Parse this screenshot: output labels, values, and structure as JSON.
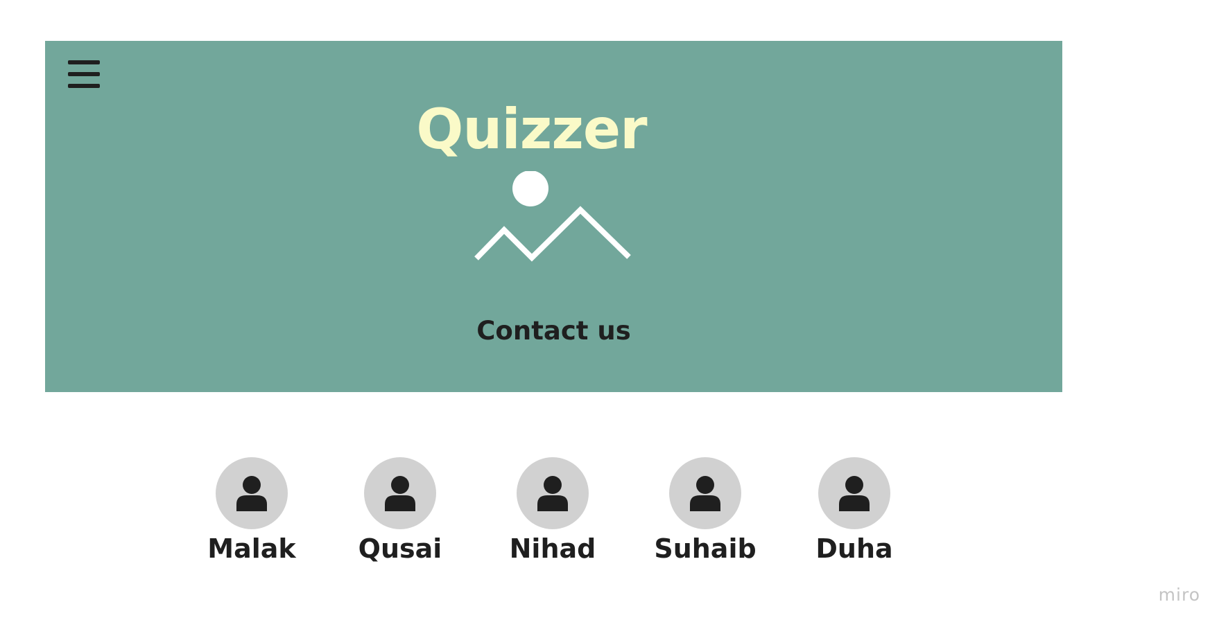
{
  "header": {
    "menu_icon": "hamburger-menu-icon",
    "title": "Quizzer",
    "image_icon": "image-placeholder-icon",
    "contact_link": "Contact us"
  },
  "team": {
    "members": [
      {
        "name": "Malak",
        "icon": "user-icon"
      },
      {
        "name": "Qusai",
        "icon": "user-icon"
      },
      {
        "name": "Nihad",
        "icon": "user-icon"
      },
      {
        "name": "Suhaib",
        "icon": "user-icon"
      },
      {
        "name": "Duha",
        "icon": "user-icon"
      }
    ]
  },
  "watermark": "miro",
  "colors": {
    "hero_background": "#72a79b",
    "title_color": "#fafac8",
    "text_dark": "#1f1f1f",
    "avatar_background": "#d1d1d1",
    "watermark": "#c4c4c4"
  }
}
